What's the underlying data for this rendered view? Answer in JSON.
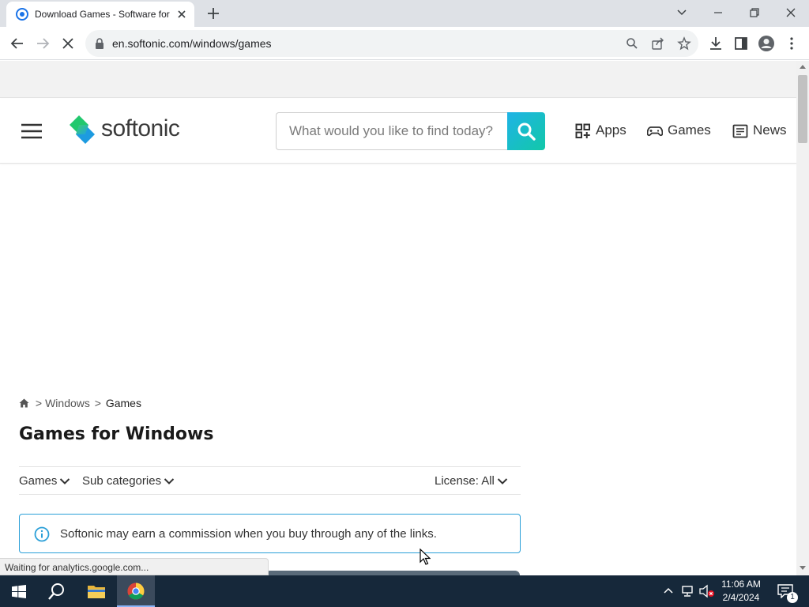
{
  "browser": {
    "tab_title": "Download Games - Software for",
    "url": "en.softonic.com/windows/games",
    "status_text": "Waiting for analytics.google.com..."
  },
  "site": {
    "logo_text": "softonic",
    "search_placeholder": "What would you like to find today?",
    "nav": [
      {
        "label": "Apps",
        "icon": "apps-grid-icon"
      },
      {
        "label": "Games",
        "icon": "gamepad-icon"
      },
      {
        "label": "News",
        "icon": "news-icon"
      }
    ],
    "brand_colors": {
      "search_gradient_start": "#1fb3e6",
      "search_gradient_end": "#12c8a8",
      "notice_border": "#2a9fd8"
    }
  },
  "page": {
    "breadcrumb": {
      "sep": ">",
      "items": [
        "Windows",
        "Games"
      ]
    },
    "title": "Games for Windows",
    "filters": {
      "category": "Games",
      "subcategories": "Sub categories",
      "license": "License: All"
    },
    "notice": "Softonic may earn a commission when you buy through any of the links."
  },
  "taskbar": {
    "time": "11:06 AM",
    "date": "2/4/2024",
    "notification_count": "1"
  }
}
